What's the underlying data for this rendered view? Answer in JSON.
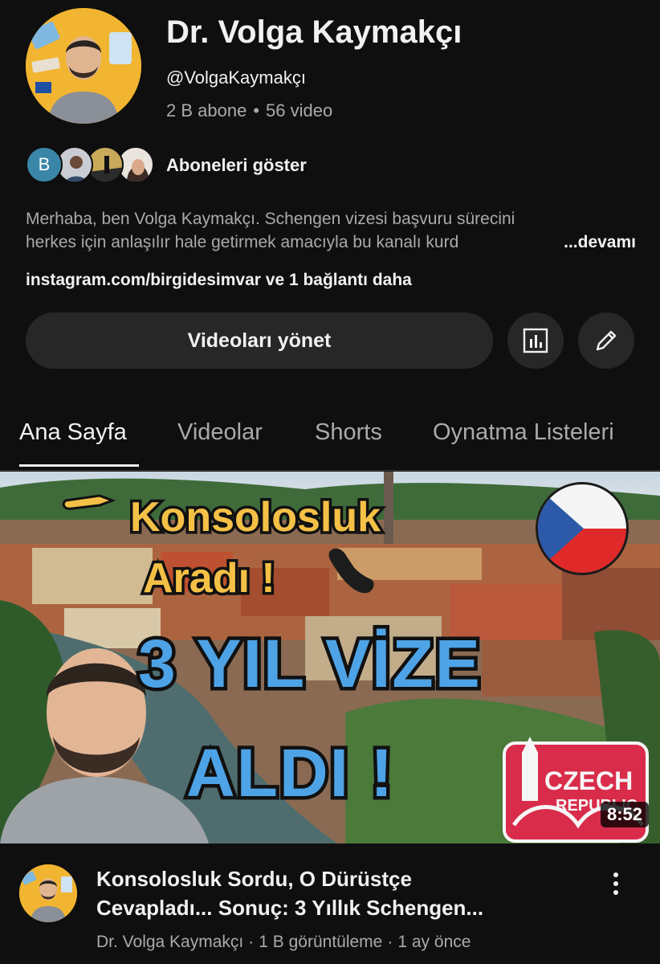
{
  "channel": {
    "name": "Dr. Volga Kaymakçı",
    "handle": "@VolgaKaymakçı",
    "subscribers": "2 B abone",
    "separator": "•",
    "video_count": "56 video",
    "show_subscribers_label": "Aboneleri göster",
    "subscriber_initial": "B",
    "description_line1": "Merhaba, ben Volga Kaymakçı. Schengen vizesi başvuru sürecini",
    "description_line2": "herkes için anlaşılır hale getirmek amacıyla bu kanalı kurd",
    "more_label": "...devamı",
    "links_text": "instagram.com/birgidesimvar ve 1 bağlantı daha",
    "manage_videos_label": "Videoları yönet",
    "accent_color": "#f2b531"
  },
  "tabs": [
    {
      "label": "Ana Sayfa",
      "active": true
    },
    {
      "label": "Videolar",
      "active": false
    },
    {
      "label": "Shorts",
      "active": false
    },
    {
      "label": "Oynatma Listeleri",
      "active": false
    }
  ],
  "video": {
    "thumbnail_text": {
      "line1": "Konsolosluk",
      "line2": "Aradı !",
      "line3": "3 YIL VİZE",
      "line4": "ALDI !",
      "badge_line1": "CZECH",
      "badge_line2": "REPUBLIC"
    },
    "duration": "8:52",
    "title_line1": "Konsolosluk Sordu, O Dürüstçe",
    "title_line2": "Cevapladı... Sonuç: 3 Yıllık Schengen...",
    "channel": "Dr. Volga Kaymakçı",
    "meta_separator": "·",
    "views": "1 B görüntüleme",
    "age": "1 ay önce"
  },
  "icons": {
    "analytics": "bar-chart-icon",
    "edit": "pencil-icon",
    "more": "vertical-dots-icon",
    "pointing": "pointing-hand-icon",
    "phone": "phone-icon",
    "flag": "czech-flag-icon"
  }
}
